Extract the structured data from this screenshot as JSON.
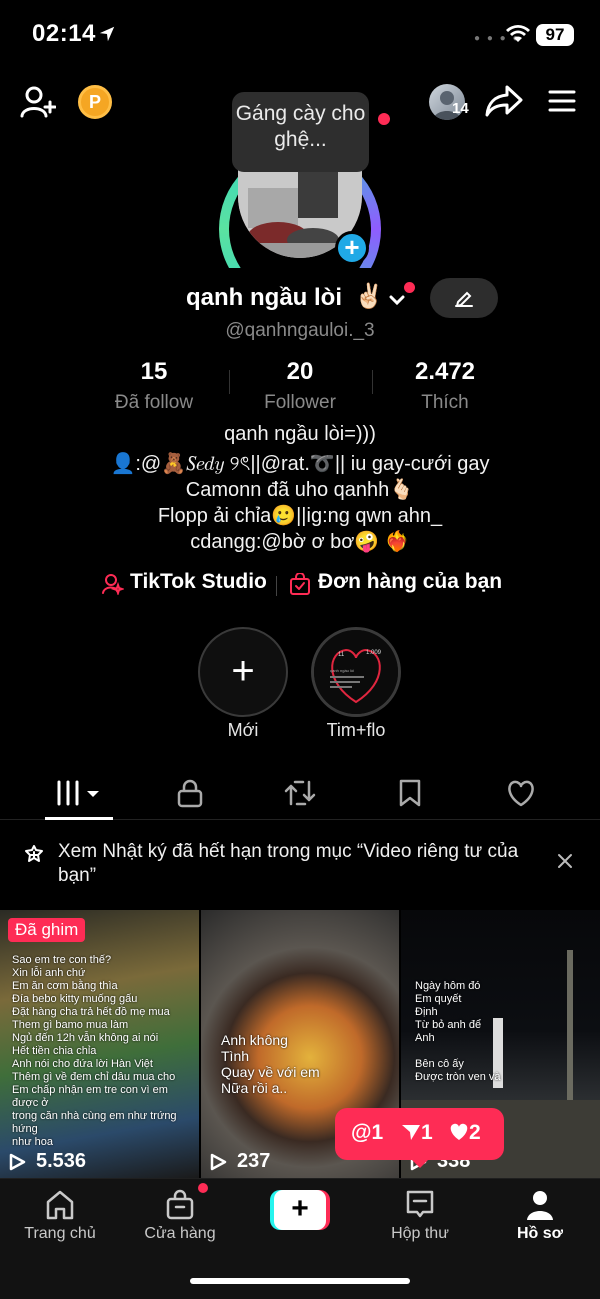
{
  "status_bar": {
    "time": "02:14",
    "battery": "97"
  },
  "header": {
    "coin_label": "P",
    "friends_count": "14",
    "tooltip": "Gáng cày cho ghệ..."
  },
  "profile": {
    "display_name": "qanh ngầu lòi",
    "name_emoji": "✌🏻",
    "handle": "@qanhngauloi._3"
  },
  "stats": [
    {
      "value": "15",
      "label": "Đã follow"
    },
    {
      "value": "20",
      "label": "Follower"
    },
    {
      "value": "2.472",
      "label": "Thích"
    }
  ],
  "bio": [
    "qanh ngầu lòi=)))",
    "👤:@🧸𝑆𝑒𝑑𝑦 ୨ৎ||@rat.➰|| iu gay-cưới gay",
    "Camonn đã uho qanhh🫰🏻",
    "Flopp ải chỉa🥲||ig:ng qwn ahn_",
    "cdangg:@bờ ơ bơ🤪 ❤️‍🔥"
  ],
  "links": {
    "studio": "TikTok Studio",
    "orders": "Đơn hàng của bạn"
  },
  "highlights": [
    {
      "label": "Mới",
      "icon": "plus"
    },
    {
      "label": "Tim+flo",
      "icon": "thumbnail"
    }
  ],
  "highlight_thumb": {
    "num1": "11",
    "num2": "1.009",
    "caption": "qanh ngầu lòi"
  },
  "notice": {
    "text": "Xem Nhật ký đã hết hạn trong mục “Video riêng tư của bạn”"
  },
  "videos": [
    {
      "pinned_label": "Đã ghim",
      "views": "5.536",
      "caption": "Sao em tre con thế?\nXin lỗi anh chứ\nEm ăn cơm bằng thìa\nĐía bebo kitty muống gấu\nĐặt hàng cha trả hết đồ mẹ mua\nThem gì bamo mua làm\nNgủ đến 12h vẫn không ai nói\nHết tiền chia chỉa\nAnh nói cho đứa lời Hàn Việt\nThêm gì về đem chỉ dâu mua cho\nEm chấp nhận em tre con vì em được ở\ntrong căn nhà cùng em như trứng hứng\nnhư hoa"
    },
    {
      "views": "237",
      "caption": "Anh không\nTình\nQuay về với em\nNữa rồi a.."
    },
    {
      "views": "338",
      "caption": "Ngày hôm đó\nEm quyết\nĐịnh\nTừ bỏ anh để\nAnh\n\nBên cô ấy\nĐược tròn ven và"
    }
  ],
  "activity": {
    "mentions": "1",
    "shares": "1",
    "likes": "2"
  },
  "nav": {
    "home": "Trang chủ",
    "shop": "Cửa hàng",
    "inbox": "Hộp thư",
    "profile": "Hồ sơ"
  },
  "colors": {
    "accent": "#fe2c55",
    "teal": "#25f4ee",
    "coin": "#f5a623",
    "link_icon": "#fe2c55"
  }
}
